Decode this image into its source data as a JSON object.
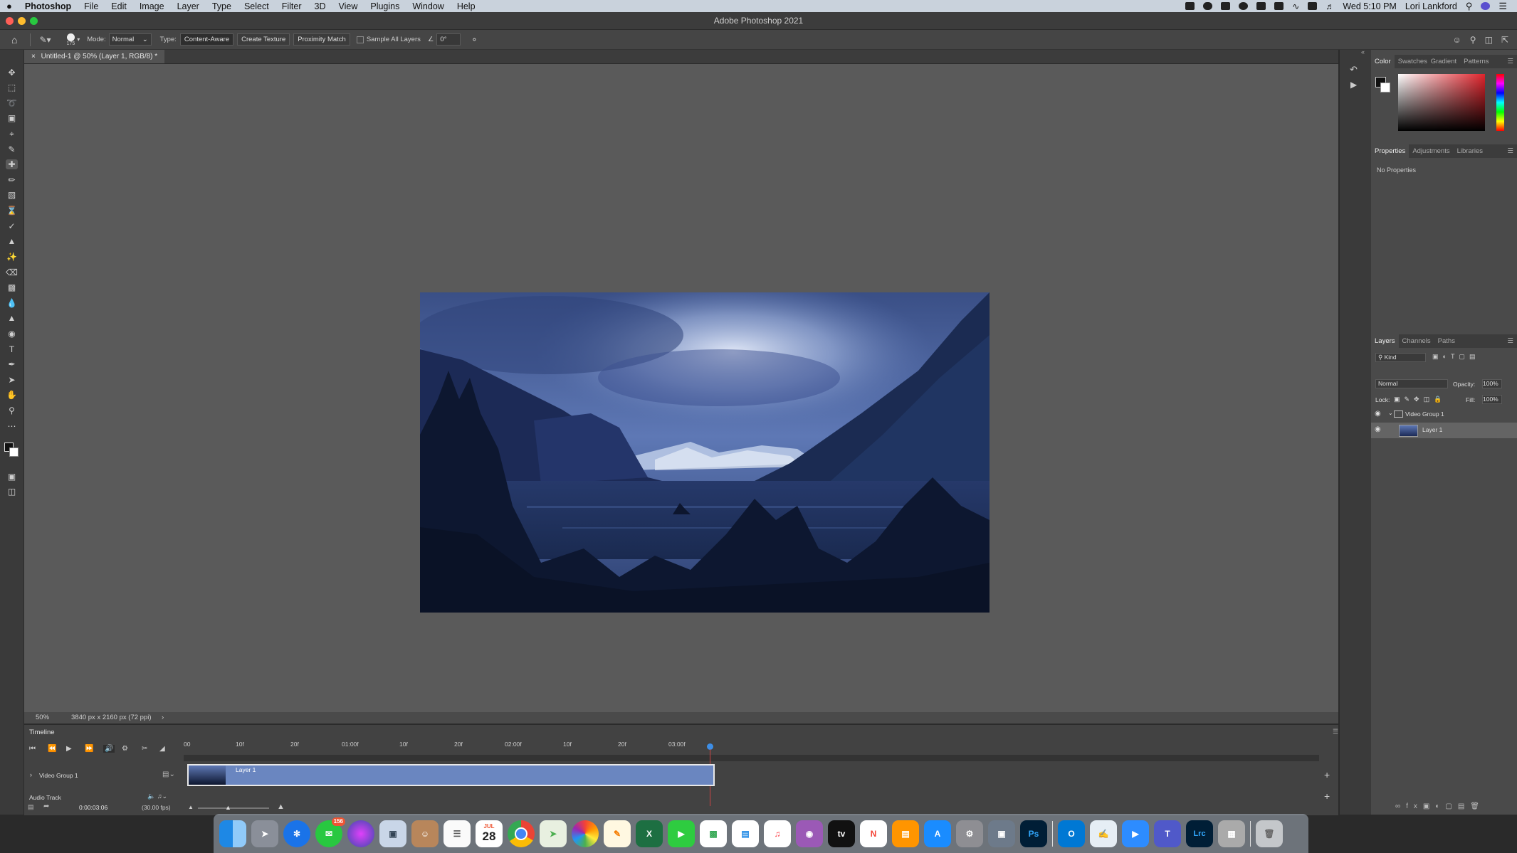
{
  "menubar": {
    "app_name": "Photoshop",
    "items": [
      "File",
      "Edit",
      "Image",
      "Layer",
      "Type",
      "Select",
      "Filter",
      "3D",
      "View",
      "Plugins",
      "Window",
      "Help"
    ],
    "clock": "Wed 5:10 PM",
    "user": "Lori Lankford"
  },
  "window": {
    "title": "Adobe Photoshop 2021"
  },
  "options_bar": {
    "brush_size": "175",
    "mode_label": "Mode:",
    "mode_value": "Normal",
    "type_label": "Type:",
    "type_buttons": [
      "Content-Aware",
      "Create Texture",
      "Proximity Match"
    ],
    "sample_all_layers": "Sample All Layers",
    "angle_value": "0°"
  },
  "document": {
    "tab_title": "Untitled-1 @ 50% (Layer 1, RGB/8) *"
  },
  "status": {
    "zoom": "50%",
    "doc_info": "3840 px x 2160 px (72 ppi)"
  },
  "color_panel": {
    "tabs": [
      "Color",
      "Swatches",
      "Gradient",
      "Patterns"
    ]
  },
  "properties_panel": {
    "tabs": [
      "Properties",
      "Adjustments",
      "Libraries"
    ],
    "empty_text": "No Properties"
  },
  "layers_panel": {
    "tabs": [
      "Layers",
      "Channels",
      "Paths"
    ],
    "filter_kind": "Kind",
    "blend_mode": "Normal",
    "opacity_label": "Opacity:",
    "opacity_value": "100%",
    "lock_label": "Lock:",
    "fill_label": "Fill:",
    "fill_value": "100%",
    "layers": [
      {
        "name": "Video Group 1"
      },
      {
        "name": "Layer 1"
      }
    ]
  },
  "timeline": {
    "title": "Timeline",
    "ruler_labels": [
      "00",
      "10f",
      "20f",
      "01:00f",
      "10f",
      "20f",
      "02:00f",
      "10f",
      "20f",
      "03:00f"
    ],
    "track_group": "Video Group 1",
    "clip_name": "Layer 1",
    "audio_track": "Audio Track",
    "timecode": "0:00:03:06",
    "fps": "(30.00 fps)"
  },
  "dock": {
    "calendar_day": "28",
    "calendar_month": "JUL",
    "messages_badge": "156",
    "photoshop_label": "Ps",
    "lightroom_label": "Lrc",
    "tv_label": "tv"
  }
}
